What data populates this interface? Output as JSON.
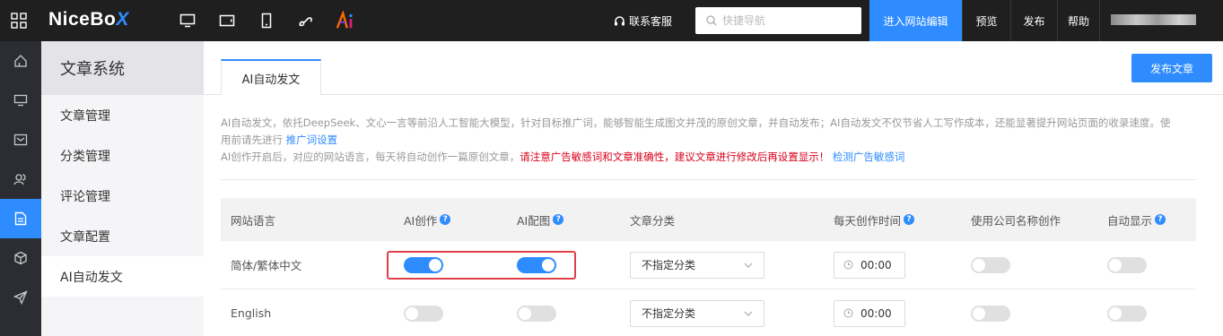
{
  "topbar": {
    "logo_main": "NiceBo",
    "logo_x": "X",
    "support": "联系客服",
    "search_placeholder": "快捷导航",
    "enter_edit": "进入网站编辑",
    "preview": "预览",
    "publish": "发布",
    "help": "帮助"
  },
  "sidebar": {
    "title": "文章系统",
    "items": [
      {
        "label": "文章管理"
      },
      {
        "label": "分类管理"
      },
      {
        "label": "评论管理"
      },
      {
        "label": "文章配置"
      },
      {
        "label": "AI自动发文",
        "active": true
      }
    ]
  },
  "main": {
    "tab": "AI自动发文",
    "publish_button": "发布文章",
    "desc_line1": "AI自动发文，依托DeepSeek、文心一言等前沿人工智能大模型，针对目标推广词，能够智能生成图文并茂的原创文章，并自动发布；AI自动发文不仅节省人工写作成本，还能显著提升网站页面的收录速度。使",
    "desc_line2_prefix": "用前请先进行 ",
    "desc_link1": "推广词设置",
    "desc_line3_prefix": "AI创作开启后，对应的网站语言，每天将自动创作一篇原创文章，",
    "desc_warn": "请注意广告敏感词和文章准确性，建议文章进行修改后再设置显示！",
    "desc_link2": " 检测广告敏感词"
  },
  "table": {
    "headers": {
      "lang": "网站语言",
      "ai_create": "AI创作",
      "ai_image": "AI配图",
      "category": "文章分类",
      "time": "每天创作时间",
      "company": "使用公司名称创作",
      "auto_show": "自动显示"
    },
    "rows": [
      {
        "lang": "简体/繁体中文",
        "ai_create": true,
        "ai_image": true,
        "category": "不指定分类",
        "time": "00:00",
        "company": false,
        "auto_show": false
      },
      {
        "lang": "English",
        "ai_create": false,
        "ai_image": false,
        "category": "不指定分类",
        "time": "00:00",
        "company": false,
        "auto_show": false
      }
    ]
  },
  "colors": {
    "accent": "#2f8cff",
    "topbar": "#1f1f1f",
    "warning": "#d9001b",
    "highlight_border": "#e0404a"
  }
}
